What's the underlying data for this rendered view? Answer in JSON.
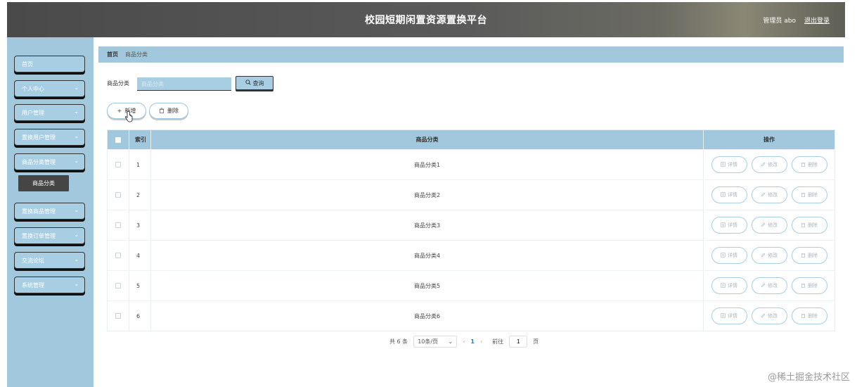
{
  "header": {
    "title": "校园短期闲置资源置换平台",
    "user_label": "管理员 abo",
    "logout_label": "退出登录"
  },
  "sidebar": {
    "items": [
      {
        "label": "首页"
      },
      {
        "label": "个人中心"
      },
      {
        "label": "用户管理"
      },
      {
        "label": "置换用户管理"
      },
      {
        "label": "商品分类管理"
      },
      {
        "label": "置换商品管理"
      },
      {
        "label": "置换订单管理"
      },
      {
        "label": "交流论坛"
      },
      {
        "label": "系统管理"
      }
    ],
    "active_sub": "商品分类"
  },
  "breadcrumb": {
    "home": "首页",
    "current": "商品分类"
  },
  "search": {
    "label": "商品分类",
    "placeholder": "商品分类",
    "value": "",
    "query_label": "查询"
  },
  "actions": {
    "add_label": "新增",
    "delete_label": "删除"
  },
  "table": {
    "headers": {
      "index": "索引",
      "name": "商品分类",
      "ops": "操作"
    },
    "op_labels": {
      "detail": "详情",
      "edit": "修改",
      "delete": "删除"
    },
    "rows": [
      {
        "index": "1",
        "name": "商品分类1"
      },
      {
        "index": "2",
        "name": "商品分类2"
      },
      {
        "index": "3",
        "name": "商品分类3"
      },
      {
        "index": "4",
        "name": "商品分类4"
      },
      {
        "index": "5",
        "name": "商品分类5"
      },
      {
        "index": "6",
        "name": "商品分类6"
      }
    ]
  },
  "pagination": {
    "total": "共 6 条",
    "page_size": "10条/页",
    "current_page": "1",
    "goto_label": "前往",
    "goto_value": "1",
    "page_unit": "页"
  },
  "watermark": "@稀土掘金技术社区",
  "colors": {
    "accent": "#a2c8dd",
    "header_bg": "#4a4a4a",
    "sub_active_bg": "#454545"
  }
}
